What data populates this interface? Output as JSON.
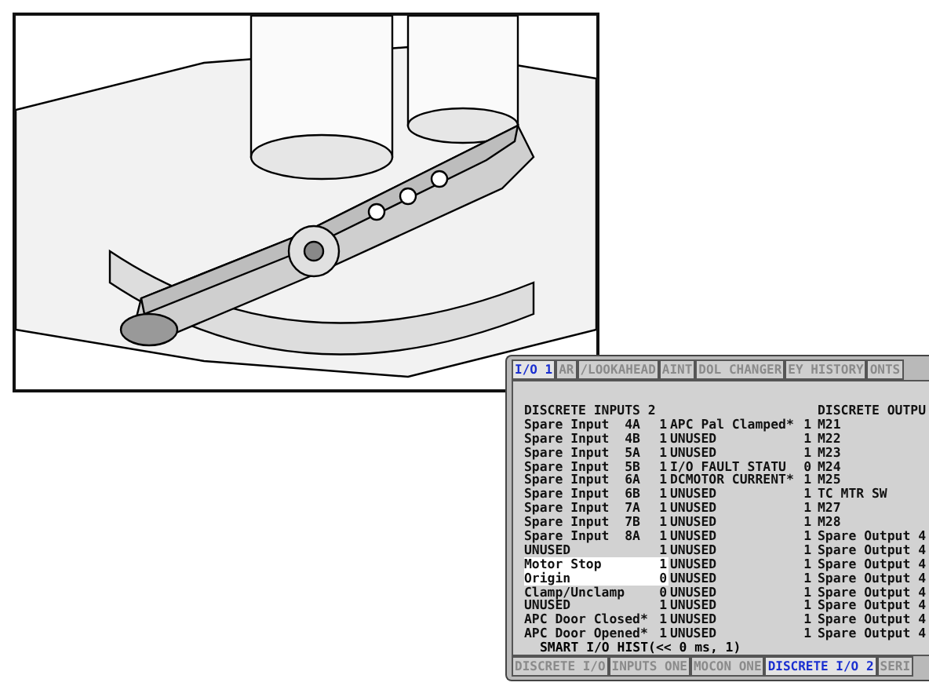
{
  "top_tabs": [
    {
      "label": "I/O 1",
      "selected": true
    },
    {
      "label": "AR",
      "selected": false
    },
    {
      "label": "/LOOKAHEAD",
      "selected": false
    },
    {
      "label": "AINT",
      "selected": false
    },
    {
      "label": "DOL CHANGER",
      "selected": false
    },
    {
      "label": "EY HISTORY",
      "selected": false
    },
    {
      "label": "ONTS",
      "selected": false
    }
  ],
  "headers": {
    "inputs": "DISCRETE INPUTS 2",
    "outputs": "DISCRETE OUTPU"
  },
  "rows": [
    {
      "input": "Spare Input  4A",
      "input_value": "1",
      "signal": "APC Pal Clamped*",
      "signal_value": "1",
      "output": "M21",
      "highlighted": false
    },
    {
      "input": "Spare Input  4B",
      "input_value": "1",
      "signal": "UNUSED",
      "signal_value": "1",
      "output": "M22",
      "highlighted": false
    },
    {
      "input": "Spare Input  5A",
      "input_value": "1",
      "signal": "UNUSED",
      "signal_value": "1",
      "output": "M23",
      "highlighted": false
    },
    {
      "input": "Spare Input  5B",
      "input_value": "1",
      "signal": "I/O FAULT STATU",
      "signal_value": "0",
      "output": "M24",
      "highlighted": false
    },
    {
      "input": "Spare Input  6A",
      "input_value": "1",
      "signal": "DCMOTOR CURRENT*",
      "signal_value": "1",
      "output": "M25",
      "highlighted": false
    },
    {
      "input": "Spare Input  6B",
      "input_value": "1",
      "signal": "UNUSED",
      "signal_value": "1",
      "output": "TC MTR SW",
      "highlighted": false
    },
    {
      "input": "Spare Input  7A",
      "input_value": "1",
      "signal": "UNUSED",
      "signal_value": "1",
      "output": "M27",
      "highlighted": false
    },
    {
      "input": "Spare Input  7B",
      "input_value": "1",
      "signal": "UNUSED",
      "signal_value": "1",
      "output": "M28",
      "highlighted": false
    },
    {
      "input": "Spare Input  8A",
      "input_value": "1",
      "signal": "UNUSED",
      "signal_value": "1",
      "output": "Spare Output 4",
      "highlighted": false
    },
    {
      "input": "UNUSED",
      "input_value": "1",
      "signal": "UNUSED",
      "signal_value": "1",
      "output": "Spare Output 4",
      "highlighted": false
    },
    {
      "input": "Motor Stop",
      "input_value": "1",
      "signal": "UNUSED",
      "signal_value": "1",
      "output": "Spare Output 4",
      "highlighted": true
    },
    {
      "input": "Origin",
      "input_value": "0",
      "signal": "UNUSED",
      "signal_value": "1",
      "output": "Spare Output 4",
      "highlighted": true
    },
    {
      "input": "Clamp/Unclamp",
      "input_value": "0",
      "signal": "UNUSED",
      "signal_value": "1",
      "output": "Spare Output 4",
      "highlighted": false
    },
    {
      "input": "UNUSED",
      "input_value": "1",
      "signal": "UNUSED",
      "signal_value": "1",
      "output": "Spare Output 4",
      "highlighted": false
    },
    {
      "input": "APC Door Closed*",
      "input_value": "1",
      "signal": "UNUSED",
      "signal_value": "1",
      "output": "Spare Output 4",
      "highlighted": false
    },
    {
      "input": "APC Door Opened*",
      "input_value": "1",
      "signal": "UNUSED",
      "signal_value": "1",
      "output": "Spare Output 4",
      "highlighted": false
    }
  ],
  "footer": "SMART I/O HIST(<< 0 ms, 1)",
  "bottom_tabs": [
    {
      "label": "DISCRETE I/O",
      "selected": false
    },
    {
      "label": "INPUTS ONE",
      "selected": false
    },
    {
      "label": "MOCON ONE",
      "selected": false
    },
    {
      "label": "DISCRETE I/O 2",
      "selected": true
    },
    {
      "label": "SERI",
      "selected": false
    }
  ]
}
